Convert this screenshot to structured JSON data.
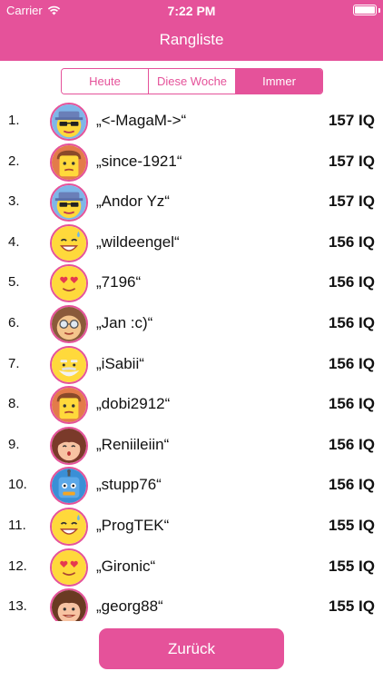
{
  "status_bar": {
    "carrier": "Carrier",
    "time": "7:22 PM"
  },
  "header": {
    "title": "Rangliste"
  },
  "segments": [
    {
      "label": "Heute",
      "active": false
    },
    {
      "label": "Diese Woche",
      "active": false
    },
    {
      "label": "Immer",
      "active": true
    }
  ],
  "leaderboard": [
    {
      "rank": "1.",
      "name": "„<-MagaM->“",
      "score": "157 IQ",
      "avatar": "cool-hat-avatar"
    },
    {
      "rank": "2.",
      "name": "„since-1921“",
      "score": "157 IQ",
      "avatar": "square-face-avatar"
    },
    {
      "rank": "3.",
      "name": "„Andor Yz“",
      "score": "157 IQ",
      "avatar": "cool-hat-avatar"
    },
    {
      "rank": "4.",
      "name": "„wildeengel“",
      "score": "156 IQ",
      "avatar": "sweat-smile-avatar"
    },
    {
      "rank": "5.",
      "name": "„7196“",
      "score": "156 IQ",
      "avatar": "heart-eyes-avatar"
    },
    {
      "rank": "6.",
      "name": "„Jan :c)“",
      "score": "156 IQ",
      "avatar": "glasses-avatar"
    },
    {
      "rank": "7.",
      "name": "„iSabii“",
      "score": "156 IQ",
      "avatar": "old-man-avatar"
    },
    {
      "rank": "8.",
      "name": "„dobi2912“",
      "score": "156 IQ",
      "avatar": "square-face-avatar"
    },
    {
      "rank": "9.",
      "name": "„Reniileiin“",
      "score": "156 IQ",
      "avatar": "girl-avatar"
    },
    {
      "rank": "10.",
      "name": "„stupp76“",
      "score": "156 IQ",
      "avatar": "robot-avatar"
    },
    {
      "rank": "11.",
      "name": "„ProgTEK“",
      "score": "155 IQ",
      "avatar": "sweat-smile-avatar"
    },
    {
      "rank": "12.",
      "name": "„Gironic“",
      "score": "155 IQ",
      "avatar": "heart-eyes-avatar"
    },
    {
      "rank": "13.",
      "name": "„georg88“",
      "score": "155 IQ",
      "avatar": "boy-avatar"
    }
  ],
  "back_button": {
    "label": "Zurück"
  },
  "colors": {
    "accent": "#e5529a",
    "emoji_yellow": "#ffd93b",
    "robot_blue": "#3a8fd6"
  }
}
